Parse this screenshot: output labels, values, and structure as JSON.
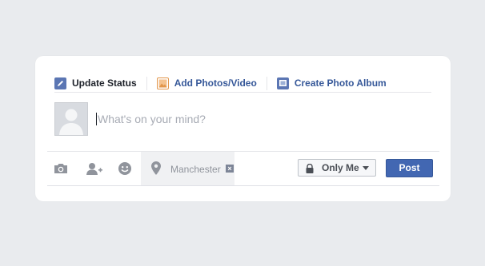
{
  "tabs": [
    {
      "label": "Update Status",
      "icon": "pencil-icon",
      "active": true
    },
    {
      "label": "Add Photos/Video",
      "icon": "photo-icon",
      "active": false
    },
    {
      "label": "Create Photo Album",
      "icon": "album-icon",
      "active": false
    }
  ],
  "composer": {
    "placeholder": "What's on your mind?"
  },
  "footer": {
    "icons": [
      "camera-icon",
      "tag-friends-icon",
      "feeling-icon"
    ],
    "location": {
      "text": "Manchester",
      "remove_glyph": "×"
    },
    "privacy": {
      "label": "Only Me"
    },
    "post_label": "Post"
  },
  "colors": {
    "background": "#e9ebee",
    "link": "#365899",
    "post_button": "#4267b2",
    "pencil_icon": "#5b76b3",
    "photo_icon": "#e2964b",
    "album_icon": "#5b76b3"
  }
}
